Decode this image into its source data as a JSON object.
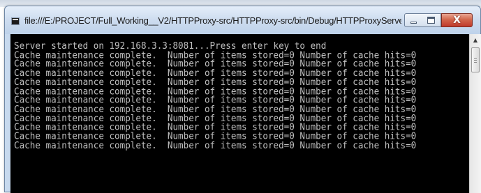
{
  "window": {
    "title": "file:///E:/PROJECT/Full_Working__V2/HTTPProxy-src/HTTPProxy-src/bin/Debug/HTTPProxyServer.E...",
    "close_glyph": "X",
    "buttons": {
      "minimize": "minimize-icon",
      "maximize": "maximize-icon",
      "close": "close-icon"
    }
  },
  "console": {
    "lines": [
      "Server started on 192.168.3.3:8081...Press enter key to end",
      "Cache maintenance complete.  Number of items stored=0 Number of cache hits=0",
      "Cache maintenance complete.  Number of items stored=0 Number of cache hits=0",
      "Cache maintenance complete.  Number of items stored=0 Number of cache hits=0",
      "Cache maintenance complete.  Number of items stored=0 Number of cache hits=0",
      "Cache maintenance complete.  Number of items stored=0 Number of cache hits=0",
      "Cache maintenance complete.  Number of items stored=0 Number of cache hits=0",
      "Cache maintenance complete.  Number of items stored=0 Number of cache hits=0",
      "Cache maintenance complete.  Number of items stored=0 Number of cache hits=0",
      "Cache maintenance complete.  Number of items stored=0 Number of cache hits=0",
      "Cache maintenance complete.  Number of items stored=0 Number of cache hits=0",
      "Cache maintenance complete.  Number of items stored=0 Number of cache hits=0"
    ],
    "text_color": "#c0c0c0",
    "background_color": "#000000"
  },
  "scrollbar": {
    "up_glyph": "▲"
  },
  "colors": {
    "titlebar": "#cddcef",
    "close_button": "#c0392b"
  }
}
